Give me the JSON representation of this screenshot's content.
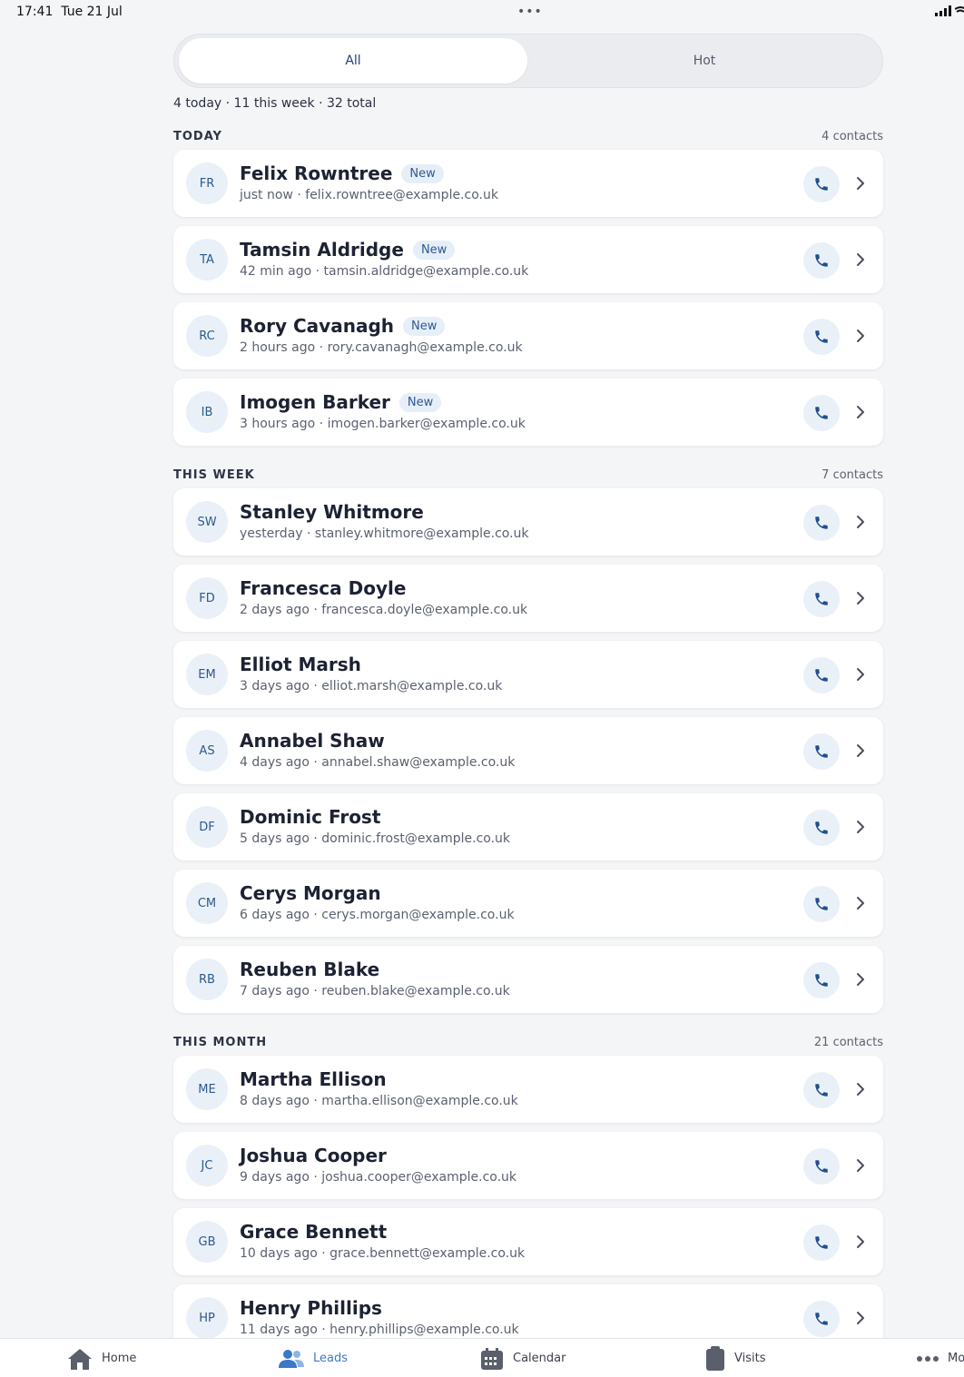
{
  "status_bar": {
    "time": "17:41",
    "date": "Tue 21 Jul",
    "dots": "•••"
  },
  "segments": [
    {
      "label": "All",
      "selected": true
    },
    {
      "label": "Hot",
      "selected": false
    }
  ],
  "summary": {
    "today_count": "4",
    "today_label": "today",
    "week_count": "11",
    "week_label": "this week",
    "total_count": "32",
    "total_label": "total",
    "separator": "·"
  },
  "sections": [
    {
      "title": "TODAY",
      "count": "4 contacts"
    },
    {
      "title": "THIS WEEK",
      "count": "7 contacts"
    },
    {
      "title": "THIS MONTH",
      "count": "21 contacts"
    }
  ],
  "contacts": [
    {
      "initials": "FR",
      "name": "Felix Rowntree",
      "badge": "New",
      "time": "just now",
      "email": "felix.rowntree@example.co.uk"
    },
    {
      "initials": "TA",
      "name": "Tamsin Aldridge",
      "badge": "New",
      "time": "42 min ago",
      "email": "tamsin.aldridge@example.co.uk"
    },
    {
      "initials": "RC",
      "name": "Rory Cavanagh",
      "badge": "New",
      "time": "2 hours ago",
      "email": "rory.cavanagh@example.co.uk"
    },
    {
      "initials": "IB",
      "name": "Imogen Barker",
      "badge": "New",
      "time": "3 hours ago",
      "email": "imogen.barker@example.co.uk"
    },
    {
      "initials": "SW",
      "name": "Stanley Whitmore",
      "badge": "",
      "time": "yesterday",
      "email": "stanley.whitmore@example.co.uk"
    },
    {
      "initials": "FD",
      "name": "Francesca Doyle",
      "badge": "",
      "time": "2 days ago",
      "email": "francesca.doyle@example.co.uk"
    },
    {
      "initials": "EM",
      "name": "Elliot Marsh",
      "badge": "",
      "time": "3 days ago",
      "email": "elliot.marsh@example.co.uk"
    },
    {
      "initials": "AS",
      "name": "Annabel Shaw",
      "badge": "",
      "time": "4 days ago",
      "email": "annabel.shaw@example.co.uk"
    },
    {
      "initials": "DF",
      "name": "Dominic Frost",
      "badge": "",
      "time": "5 days ago",
      "email": "dominic.frost@example.co.uk"
    },
    {
      "initials": "CM",
      "name": "Cerys Morgan",
      "badge": "",
      "time": "6 days ago",
      "email": "cerys.morgan@example.co.uk"
    },
    {
      "initials": "RB",
      "name": "Reuben Blake",
      "badge": "",
      "time": "7 days ago",
      "email": "reuben.blake@example.co.uk"
    },
    {
      "initials": "ME",
      "name": "Martha Ellison",
      "badge": "",
      "time": "8 days ago",
      "email": "martha.ellison@example.co.uk"
    },
    {
      "initials": "JC",
      "name": "Joshua Cooper",
      "badge": "",
      "time": "9 days ago",
      "email": "joshua.cooper@example.co.uk"
    },
    {
      "initials": "GB",
      "name": "Grace Bennett",
      "badge": "",
      "time": "10 days ago",
      "email": "grace.bennett@example.co.uk"
    },
    {
      "initials": "HP",
      "name": "Henry Phillips",
      "badge": "",
      "time": "11 days ago",
      "email": "henry.phillips@example.co.uk"
    }
  ],
  "tabbar": [
    {
      "label": "Home",
      "icon": "home-icon",
      "active": false
    },
    {
      "label": "Leads",
      "icon": "people-icon",
      "active": true
    },
    {
      "label": "Calendar",
      "icon": "calendar-icon",
      "active": false
    },
    {
      "label": "Visits",
      "icon": "clipboard-icon",
      "active": false
    },
    {
      "label": "Mo",
      "icon": "more-icon",
      "active": false
    }
  ],
  "colors": {
    "accent": "#3a78c9",
    "phone_icon": "#1f4f8f",
    "badge_bg": "#e6eef8",
    "avatar_bg": "#eaf0f7",
    "background": "#f4f5f7"
  }
}
